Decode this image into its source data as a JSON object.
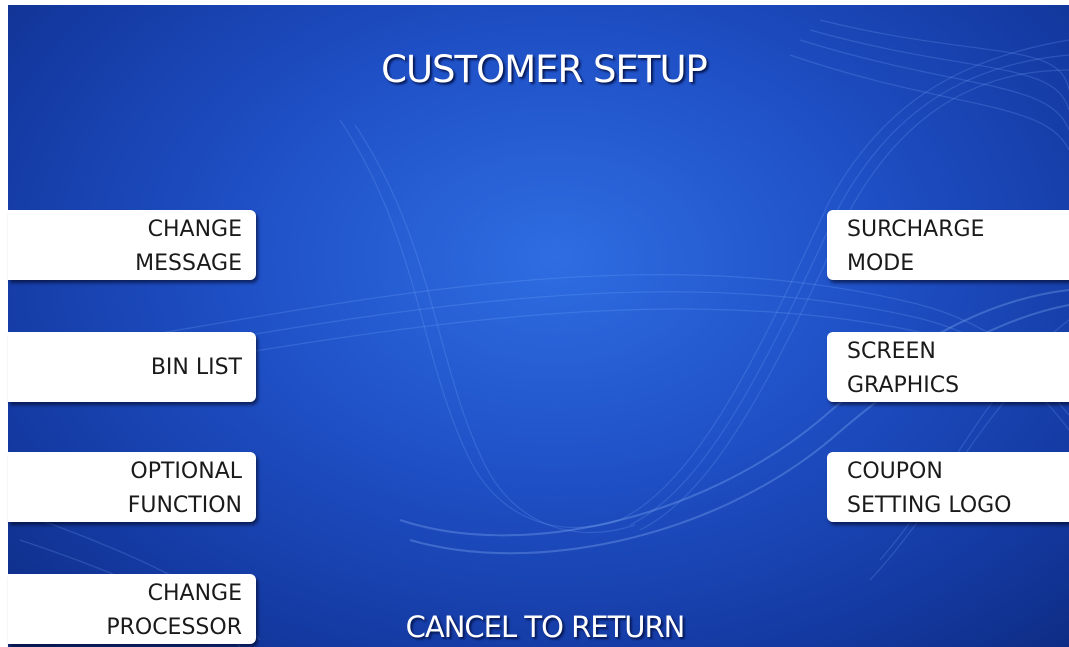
{
  "screen": {
    "title": "CUSTOMER SETUP",
    "footer": "CANCEL TO RETURN"
  },
  "left_buttons": [
    {
      "lines": [
        "CHANGE",
        "MESSAGE"
      ]
    },
    {
      "lines": [
        "BIN LIST"
      ]
    },
    {
      "lines": [
        "OPTIONAL",
        "FUNCTION"
      ]
    },
    {
      "lines": [
        "CHANGE",
        "PROCESSOR"
      ]
    }
  ],
  "right_buttons": [
    {
      "lines": [
        "SURCHARGE",
        "MODE"
      ]
    },
    {
      "lines": [
        "SCREEN",
        "GRAPHICS"
      ]
    },
    {
      "lines": [
        "COUPON",
        "SETTING LOGO"
      ]
    }
  ],
  "colors": {
    "background": "#1f50c6",
    "button": "#ffffff",
    "button_text": "#1a1a1a",
    "title_text": "#ffffff"
  }
}
